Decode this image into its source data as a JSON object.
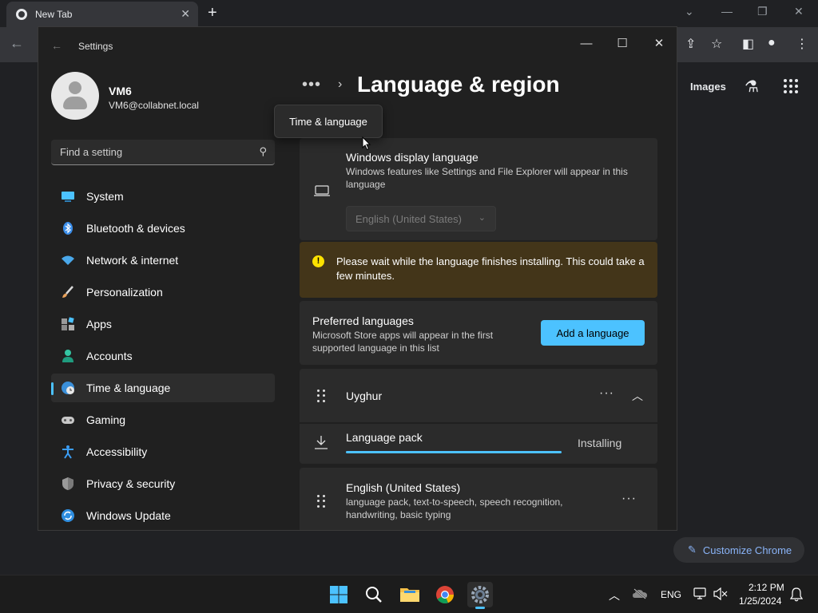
{
  "chrome": {
    "tab_title": "New Tab",
    "tab_close": "✕",
    "new_tab": "+",
    "images_link": "Images",
    "customize_label": "Customize Chrome"
  },
  "settings": {
    "window_title": "Settings",
    "user": {
      "name": "VM6",
      "email": "VM6@collabnet.local"
    },
    "search_placeholder": "Find a setting",
    "nav": [
      {
        "label": "System",
        "icon": "system-icon"
      },
      {
        "label": "Bluetooth & devices",
        "icon": "bluetooth-icon"
      },
      {
        "label": "Network & internet",
        "icon": "wifi-icon"
      },
      {
        "label": "Personalization",
        "icon": "brush-icon"
      },
      {
        "label": "Apps",
        "icon": "apps-icon"
      },
      {
        "label": "Accounts",
        "icon": "person-icon"
      },
      {
        "label": "Time & language",
        "icon": "globe-clock-icon",
        "active": true
      },
      {
        "label": "Gaming",
        "icon": "gamepad-icon"
      },
      {
        "label": "Accessibility",
        "icon": "accessibility-icon"
      },
      {
        "label": "Privacy & security",
        "icon": "shield-icon"
      },
      {
        "label": "Windows Update",
        "icon": "update-icon"
      }
    ],
    "breadcrumb_dots": "•••",
    "breadcrumb_sep": "›",
    "page_title": "Language & region",
    "tooltip": "Time & language",
    "display_language": {
      "title": "Windows display language",
      "description": "Windows features like Settings and File Explorer will appear in this language",
      "selected": "English (United States)"
    },
    "warning": "Please wait while the language finishes installing. This could take a few minutes.",
    "preferred": {
      "title": "Preferred languages",
      "description": "Microsoft Store apps will appear in the first supported language in this list",
      "add_button": "Add a language"
    },
    "languages": [
      {
        "name": "Uyghur",
        "pack_label": "Language pack",
        "pack_status": "Installing",
        "progress": 1.0
      },
      {
        "name": "English (United States)",
        "features": "language pack, text-to-speech, speech recognition, handwriting, basic typing"
      }
    ],
    "more_glyph": "···"
  },
  "taskbar": {
    "language": "ENG",
    "time": "2:12 PM",
    "date": "1/25/2024"
  },
  "colors": {
    "accent": "#4cc2ff",
    "warning_bg": "#433519",
    "warning_icon": "#fce100"
  }
}
